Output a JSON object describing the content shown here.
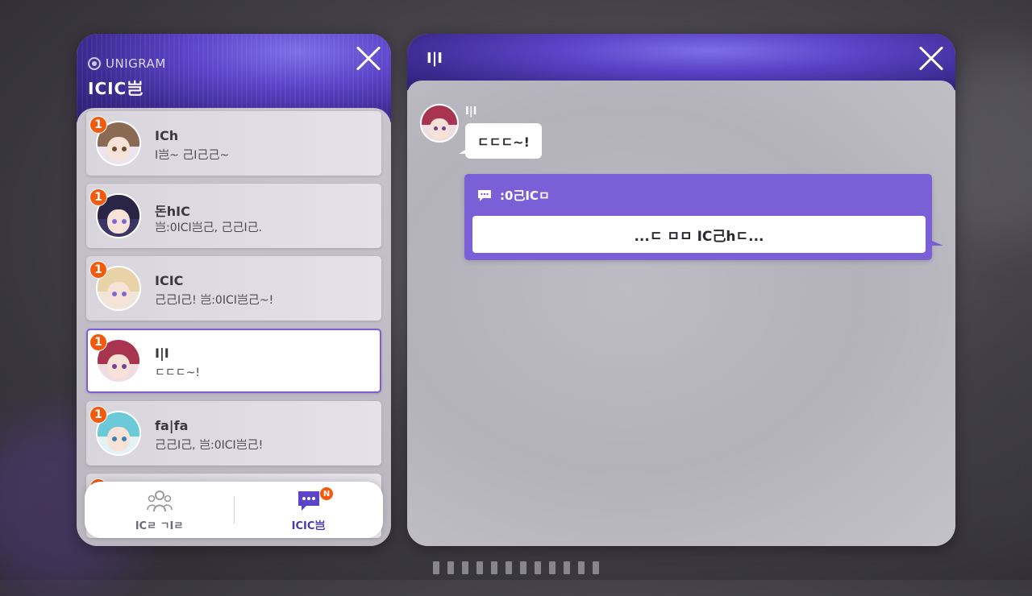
{
  "app": {
    "brand": "UNIGRAM",
    "title": "ICIC岂"
  },
  "contacts": [
    {
      "name": "ICh",
      "preview": "I岂~ 己I己己~",
      "unread": "1",
      "colors": {
        "hair": "#8a6a52",
        "eye": "#6b4c2e"
      }
    },
    {
      "name": "돈hIC",
      "preview": "岂:0ICI岂己, 己己I己.",
      "unread": "1",
      "colors": {
        "hair": "#2a2546",
        "eye": "#7c67d8"
      }
    },
    {
      "name": "ICIC",
      "preview": "己己I己! 岂:0ICI岂己~!",
      "unread": "1",
      "colors": {
        "hair": "#e8d2a8",
        "eye": "#7a6bd0"
      }
    },
    {
      "name": "I|I",
      "preview": "ㄷㄷㄷ~!",
      "unread": "1",
      "colors": {
        "hair": "#a8344f",
        "eye": "#7a3d8f"
      }
    },
    {
      "name": "fa|fa",
      "preview": "己己I己, 岂:0ICI岂己!",
      "unread": "1",
      "colors": {
        "hair": "#6cc9d8",
        "eye": "#3a7fb0"
      }
    }
  ],
  "selected_contact_index": 3,
  "bottom_nav": {
    "friends_label": "ICㄹ ㄱIㄹ",
    "chat_label": "ICIC岂",
    "new_badge": "N"
  },
  "chat": {
    "header_name": "I|I",
    "sender_name": "I|I",
    "incoming_message": "ㄷㄷㄷ~!",
    "reply_prompt": ":0己ICㅁ",
    "reply_option": "...ㄷ ㅁㅁ IC己hㄷ..."
  },
  "colors": {
    "accent_purple": "#7b5fd6",
    "badge_orange": "#f25a0e",
    "selected_border": "#7d5ce0"
  },
  "icons": {
    "close": "close-icon",
    "friends": "people-icon",
    "chat": "chat-bubble-icon",
    "reply": "message-icon"
  }
}
